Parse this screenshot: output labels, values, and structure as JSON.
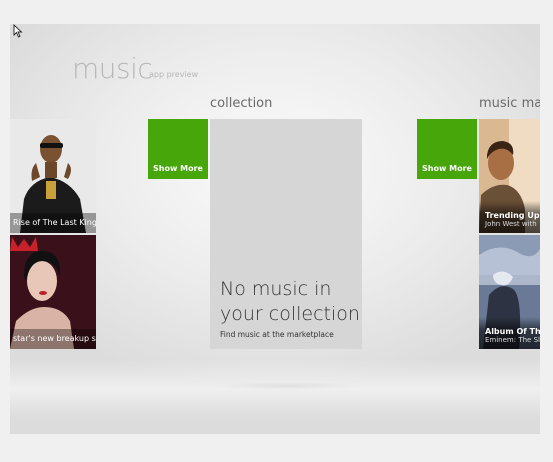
{
  "app": {
    "title": "music",
    "subtitle": "app preview"
  },
  "sections": {
    "collection_heading": "collection",
    "marketplace_heading": "music mar"
  },
  "left_tiles": [
    {
      "caption": "Rise of The Last King"
    },
    {
      "caption": "star's new breakup si..."
    }
  ],
  "show_more_label": "Show More",
  "collection": {
    "empty_message": "No music in your collection",
    "empty_sub": "Find music at the marketplace"
  },
  "marketplace_tiles": [
    {
      "title": "Trending Up",
      "subtitle": "John West with"
    },
    {
      "title": "Album Of The",
      "subtitle": "Eminem: The Sli"
    }
  ],
  "colors": {
    "accent_green": "#46a60a",
    "background": "#ececec"
  }
}
